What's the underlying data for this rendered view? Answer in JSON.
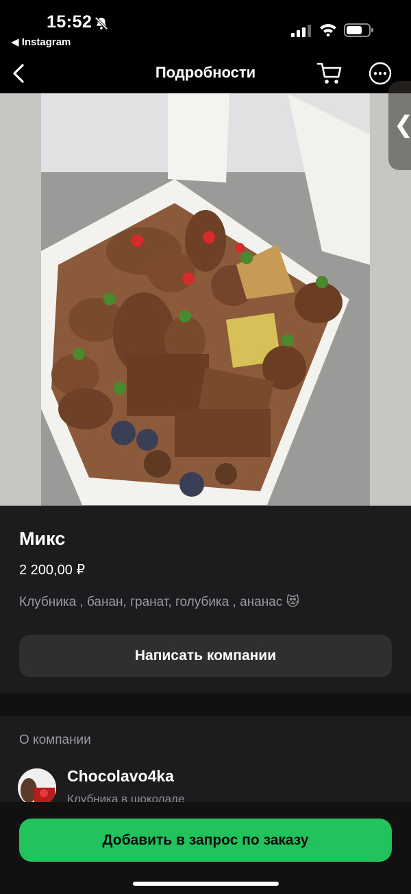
{
  "status_bar": {
    "time": "15:52",
    "back_app": "◀ Instagram"
  },
  "nav": {
    "title": "Подробности"
  },
  "product": {
    "title": "Микс",
    "price": "2 200,00 ₽",
    "description": "Клубника , банан, гранат, голубика , ананас 😻",
    "message_button": "Написать компании"
  },
  "company": {
    "header": "О компании",
    "name": "Chocolavo4ka",
    "subtitle": "Клубника в шоколаде"
  },
  "bottom": {
    "add_button": "Добавить в запрос по заказу"
  },
  "colors": {
    "accent_green": "#22c25c",
    "card_bg": "#1c1c1e",
    "button_bg": "#2f2f31"
  }
}
